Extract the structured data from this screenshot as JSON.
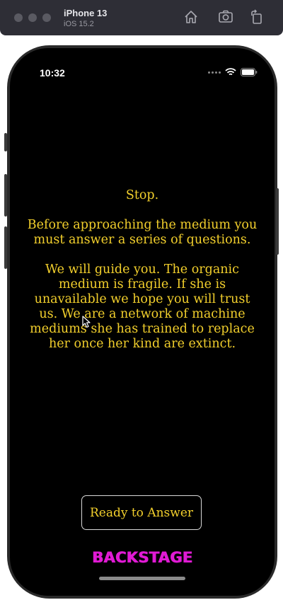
{
  "simulator": {
    "device_name": "iPhone 13",
    "os_version": "iOS 15.2",
    "buttons": [
      "home-icon",
      "screenshot-icon",
      "rotate-icon"
    ]
  },
  "status_bar": {
    "time": "10:32",
    "icons": [
      "signal-dots-icon",
      "wifi-icon",
      "battery-icon"
    ]
  },
  "message": {
    "heading": "Stop.",
    "paragraph1": "Before approaching the medium you must answer a series of questions.",
    "paragraph2": "We will guide you. The organic medium is fragile. If she is unavailable we hope you will trust us. We are a network of machine mediums she has trained to replace her once her kind are extinct."
  },
  "ready_button": {
    "label": "Ready to Answer"
  },
  "logo": {
    "text": "BACKSTAGE"
  },
  "colors": {
    "accent_text": "#f2cf2c",
    "logo": "#e01ad4",
    "background": "#000000"
  }
}
